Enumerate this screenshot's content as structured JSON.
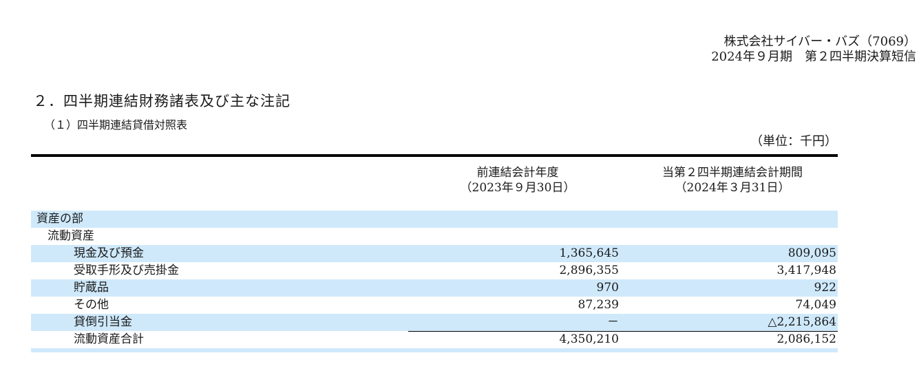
{
  "header": {
    "company": "株式会社サイバー・バズ（7069）",
    "report": "2024年９月期　第２四半期決算短信"
  },
  "section_title": "２．四半期連結財務諸表及び主な注記",
  "subsection_title": "（１）四半期連結貸借対照表",
  "unit_label": "（単位：千円）",
  "table": {
    "columns": [
      {
        "line1": "前連結会計年度",
        "line2": "（2023年９月30日）"
      },
      {
        "line1": "当第２四半期連結会計期間",
        "line2": "（2024年３月31日）"
      }
    ],
    "rows": [
      {
        "label": "資産の部",
        "prev": "",
        "curr": ""
      },
      {
        "label": "流動資産",
        "prev": "",
        "curr": ""
      },
      {
        "label": "現金及び預金",
        "prev": "1,365,645",
        "curr": "809,095"
      },
      {
        "label": "受取手形及び売掛金",
        "prev": "2,896,355",
        "curr": "3,417,948"
      },
      {
        "label": "貯蔵品",
        "prev": "970",
        "curr": "922"
      },
      {
        "label": "その他",
        "prev": "87,239",
        "curr": "74,049"
      },
      {
        "label": "貸倒引当金",
        "prev": "－",
        "curr": "△2,215,864"
      },
      {
        "label": "流動資産合計",
        "prev": "4,350,210",
        "curr": "2,086,152"
      }
    ]
  }
}
